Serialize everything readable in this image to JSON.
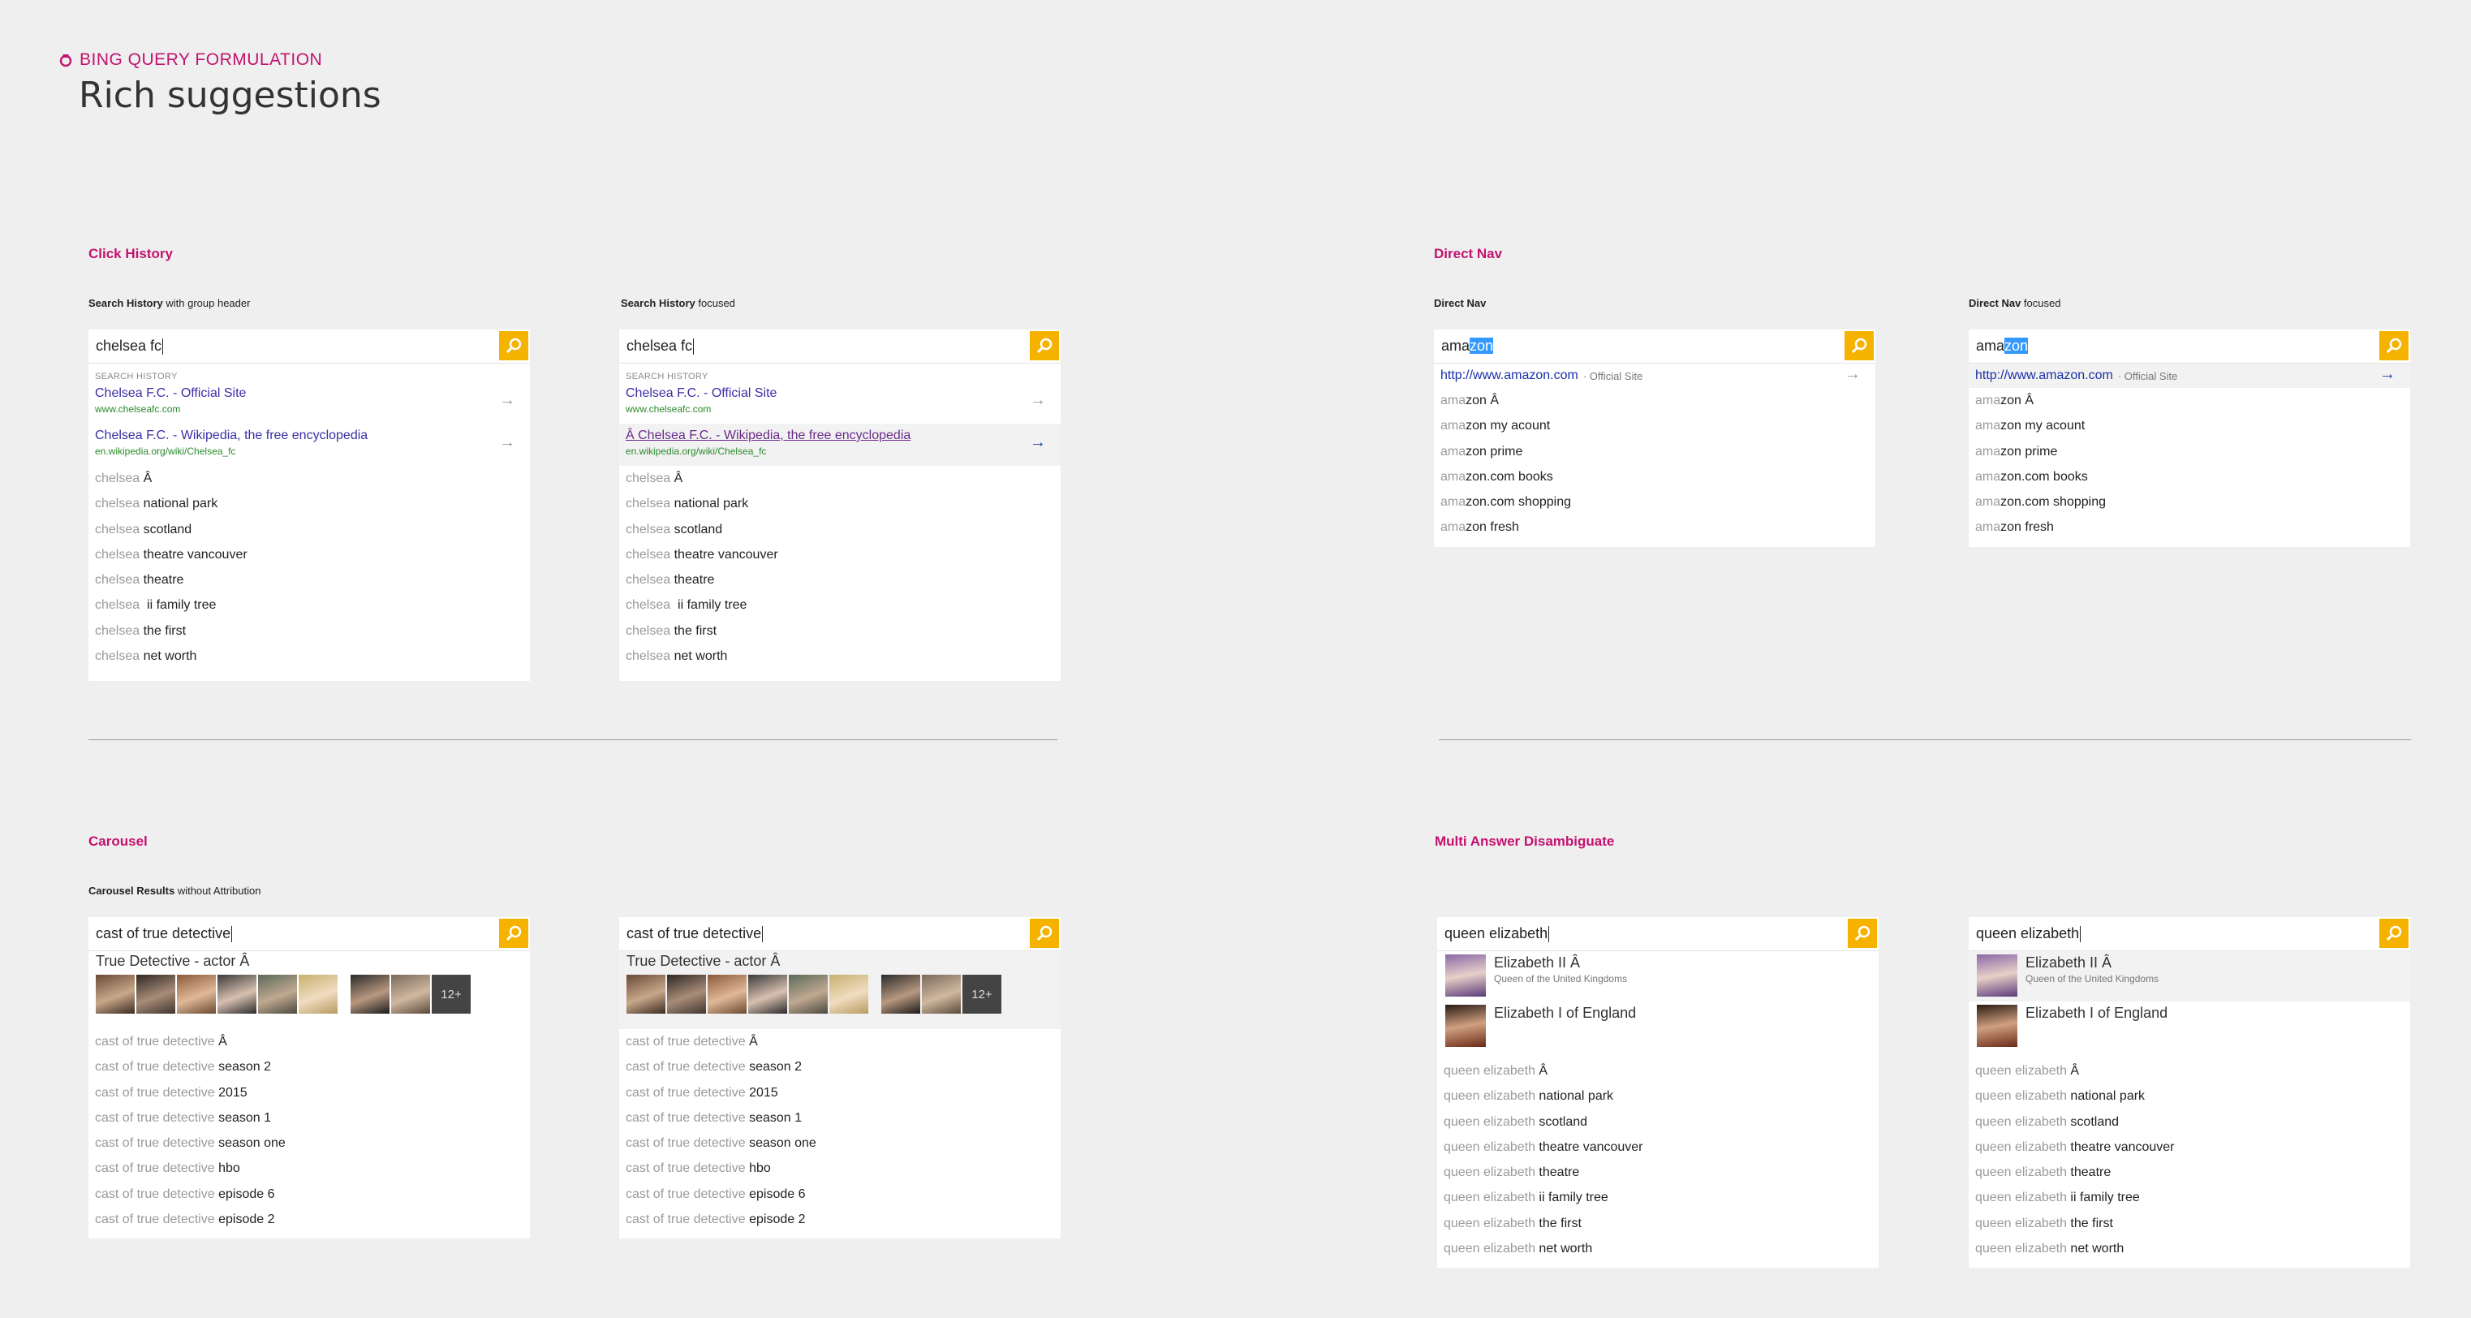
{
  "header": {
    "eyebrow": "BING QUERY FORMULATION",
    "title": "Rich suggestions"
  },
  "colors": {
    "accent": "#c3126f",
    "search_button": "#f5b300",
    "link": "#3b2fa6",
    "url_green": "#2a8a2a",
    "highlight": "#3399ff"
  },
  "click_history": {
    "section_title": "Click History",
    "panels": [
      {
        "caption_bold": "Search History",
        "caption_rest": " with group header",
        "query": "chelsea fc",
        "group_header": "SEARCH HISTORY",
        "history": [
          {
            "title": "Chelsea F.C. - Official Site",
            "url": "www.chelseafc.com"
          },
          {
            "title": "Chelsea F.C. - Wikipedia, the free encyclopedia",
            "url": "en.wikipedia.org/wiki/Chelsea_fc"
          }
        ],
        "suggestions": [
          {
            "prefix": "chelsea",
            "rest": " Â"
          },
          {
            "prefix": "chelsea",
            "rest": " national park"
          },
          {
            "prefix": "chelsea",
            "rest": " scotland"
          },
          {
            "prefix": "chelsea",
            "rest": " theatre vancouver"
          },
          {
            "prefix": "chelsea",
            "rest": " theatre"
          },
          {
            "prefix": "chelsea",
            "rest": "  ii family tree"
          },
          {
            "prefix": "chelsea",
            "rest": " the first"
          },
          {
            "prefix": "chelsea",
            "rest": " net worth"
          }
        ]
      },
      {
        "caption_bold": "Search History",
        "caption_rest": " focused",
        "query": "chelsea fc",
        "group_header": "SEARCH HISTORY",
        "history": [
          {
            "title": "Chelsea F.C. - Official Site",
            "url": "www.chelseafc.com"
          },
          {
            "title": "Â Chelsea F.C. - Wikipedia, the free encyclopedia",
            "url": "en.wikipedia.org/wiki/Chelsea_fc"
          }
        ],
        "suggestions": [
          {
            "prefix": "chelsea",
            "rest": " Â"
          },
          {
            "prefix": "chelsea",
            "rest": " national park"
          },
          {
            "prefix": "chelsea",
            "rest": " scotland"
          },
          {
            "prefix": "chelsea",
            "rest": " theatre vancouver"
          },
          {
            "prefix": "chelsea",
            "rest": " theatre"
          },
          {
            "prefix": "chelsea",
            "rest": "  ii family tree"
          },
          {
            "prefix": "chelsea",
            "rest": " the first"
          },
          {
            "prefix": "chelsea",
            "rest": " net worth"
          }
        ]
      }
    ]
  },
  "direct_nav": {
    "section_title": "Direct Nav",
    "panels": [
      {
        "caption_bold": "Direct Nav",
        "caption_rest": "",
        "query_typed": "ama",
        "query_completion": "zon",
        "nav_url": "http://www.amazon.com",
        "nav_tag": "· Official Site",
        "suggestions": [
          {
            "prefix": "ama",
            "rest": "zon Â"
          },
          {
            "prefix": "ama",
            "rest": "zon my acount"
          },
          {
            "prefix": "ama",
            "rest": "zon prime"
          },
          {
            "prefix": "ama",
            "rest": "zon.com books"
          },
          {
            "prefix": "ama",
            "rest": "zon.com shopping"
          },
          {
            "prefix": "ama",
            "rest": "zon fresh"
          }
        ]
      },
      {
        "caption_bold": "Direct Nav",
        "caption_rest": " focused",
        "query_typed": "ama",
        "query_completion": "zon",
        "nav_url": "http://www.amazon.com",
        "nav_tag": "· Official Site",
        "suggestions": [
          {
            "prefix": "ama",
            "rest": "zon Â"
          },
          {
            "prefix": "ama",
            "rest": "zon my acount"
          },
          {
            "prefix": "ama",
            "rest": "zon prime"
          },
          {
            "prefix": "ama",
            "rest": "zon.com books"
          },
          {
            "prefix": "ama",
            "rest": "zon.com shopping"
          },
          {
            "prefix": "ama",
            "rest": "zon fresh"
          }
        ]
      }
    ]
  },
  "carousel": {
    "section_title": "Carousel",
    "caption_bold": "Carousel Results",
    "caption_rest": " without Attribution",
    "panels": [
      {
        "query": "cast of true detective",
        "carousel_title": "True Detective - actor Â",
        "more_label": "12+",
        "suggestions": [
          {
            "prefix": "cast of true detective",
            "rest": " Â"
          },
          {
            "prefix": "cast of true detective",
            "rest": " season 2"
          },
          {
            "prefix": "cast of true detective",
            "rest": " 2015"
          },
          {
            "prefix": "cast of true detective",
            "rest": " season 1"
          },
          {
            "prefix": "cast of true detective",
            "rest": " season one"
          },
          {
            "prefix": "cast of true detective",
            "rest": " hbo"
          },
          {
            "prefix": "cast of true detective",
            "rest": " episode 6"
          },
          {
            "prefix": "cast of true detective",
            "rest": " episode 2"
          }
        ]
      },
      {
        "query": "cast of true detective",
        "carousel_title": "True Detective - actor Â",
        "more_label": "12+",
        "suggestions": [
          {
            "prefix": "cast of true detective",
            "rest": " Â"
          },
          {
            "prefix": "cast of true detective",
            "rest": " season 2"
          },
          {
            "prefix": "cast of true detective",
            "rest": " 2015"
          },
          {
            "prefix": "cast of true detective",
            "rest": " season 1"
          },
          {
            "prefix": "cast of true detective",
            "rest": " season one"
          },
          {
            "prefix": "cast of true detective",
            "rest": " hbo"
          },
          {
            "prefix": "cast of true detective",
            "rest": " episode 6"
          },
          {
            "prefix": "cast of true detective",
            "rest": " episode 2"
          }
        ]
      }
    ]
  },
  "multi_answer": {
    "section_title": "Multi Answer Disambiguate",
    "panels": [
      {
        "query": "queen elizabeth",
        "answers": [
          {
            "name": "Elizabeth II Â",
            "subtitle": "Queen of the United Kingdoms"
          },
          {
            "name": "Elizabeth I of England",
            "subtitle": ""
          }
        ],
        "suggestions": [
          {
            "prefix": "queen elizabeth",
            "rest": " Â"
          },
          {
            "prefix": "queen elizabeth",
            "rest": " national park"
          },
          {
            "prefix": "queen elizabeth",
            "rest": " scotland"
          },
          {
            "prefix": "queen elizabeth",
            "rest": " theatre vancouver"
          },
          {
            "prefix": "queen elizabeth",
            "rest": " theatre"
          },
          {
            "prefix": "queen elizabeth",
            "rest": " ii family tree"
          },
          {
            "prefix": "queen elizabeth",
            "rest": " the first"
          },
          {
            "prefix": "queen elizabeth",
            "rest": " net worth"
          }
        ]
      },
      {
        "query": "queen elizabeth",
        "answers": [
          {
            "name": "Elizabeth II Â",
            "subtitle": "Queen of the United Kingdoms"
          },
          {
            "name": "Elizabeth I of England",
            "subtitle": ""
          }
        ],
        "suggestions": [
          {
            "prefix": "queen elizabeth",
            "rest": " Â"
          },
          {
            "prefix": "queen elizabeth",
            "rest": " national park"
          },
          {
            "prefix": "queen elizabeth",
            "rest": " scotland"
          },
          {
            "prefix": "queen elizabeth",
            "rest": " theatre vancouver"
          },
          {
            "prefix": "queen elizabeth",
            "rest": " theatre"
          },
          {
            "prefix": "queen elizabeth",
            "rest": " ii family tree"
          },
          {
            "prefix": "queen elizabeth",
            "rest": " the first"
          },
          {
            "prefix": "queen elizabeth",
            "rest": " net worth"
          }
        ]
      }
    ]
  },
  "icons": {
    "search_button": "search-icon",
    "logo": "bing-logo-icon",
    "nav_arrow": "arrow-right-icon"
  }
}
